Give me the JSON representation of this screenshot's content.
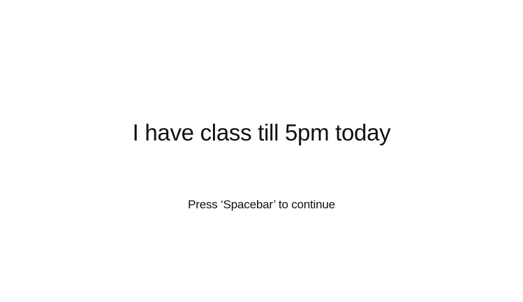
{
  "stimulus": {
    "statement": "I have class till 5pm today",
    "prompt": "Press ‘Spacebar’ to continue"
  },
  "colors": {
    "background": "#ffffff",
    "text": "#111111"
  }
}
